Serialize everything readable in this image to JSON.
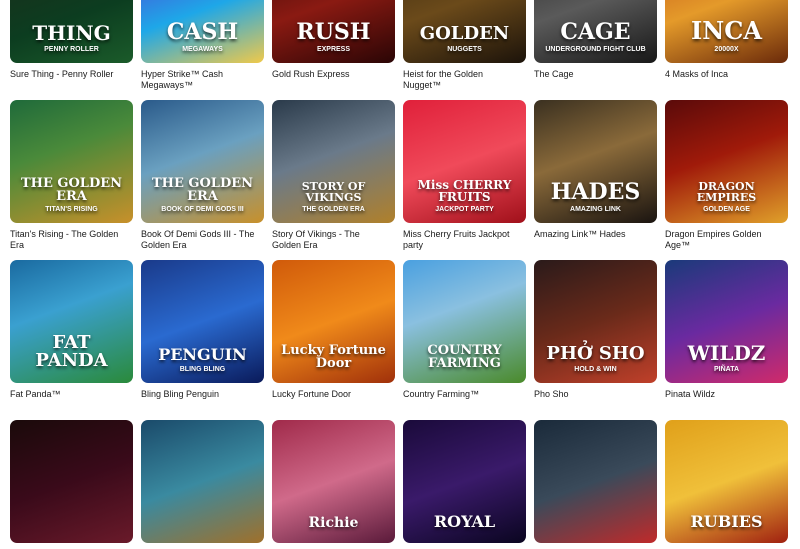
{
  "games": [
    {
      "title": "Sure Thing - Penny Roller",
      "art": "THING",
      "sub": "PENNY ROLLER",
      "bg": "linear-gradient(160deg,#1e2a1a,#0c3d20 60%,#1b5b2a)",
      "fs": 20
    },
    {
      "title": "Hyper Strike™ Cash Megaways™",
      "art": "CASH",
      "sub": "MEGAWAYS",
      "bg": "linear-gradient(160deg,#5b2fd0,#1ea7e8 55%,#f0c94a)",
      "fs": 22
    },
    {
      "title": "Gold Rush Express",
      "art": "RUSH",
      "sub": "EXPRESS",
      "bg": "linear-gradient(160deg,#3b0b0b,#8a1a12 50%,#2a0505)",
      "fs": 22
    },
    {
      "title": "Heist for the Golden Nugget™",
      "art": "GOLDEN",
      "sub": "NUGGETS",
      "bg": "linear-gradient(160deg,#3a2a12,#6b4a1a 50%,#1c130a)",
      "fs": 18
    },
    {
      "title": "The Cage",
      "art": "CAGE",
      "sub": "UNDERGROUND FIGHT CLUB",
      "bg": "linear-gradient(160deg,#2a2a2a,#5a5a5a 50%,#181818)",
      "fs": 22
    },
    {
      "title": "4 Masks of Inca",
      "art": "INCA",
      "sub": "20000X",
      "bg": "linear-gradient(160deg,#c2521a,#e49a2a 50%,#6b2a0a)",
      "fs": 24
    },
    {
      "title": "Titan's Rising - The Golden Era",
      "art": "THE GOLDEN ERA",
      "sub": "TITAN'S RISING",
      "bg": "linear-gradient(160deg,#1f6a3a,#4a8a3a 40%,#c8902a)",
      "fs": 13
    },
    {
      "title": "Book Of Demi Gods III - The Golden Era",
      "art": "THE GOLDEN ERA",
      "sub": "BOOK OF DEMI GODS III",
      "bg": "linear-gradient(160deg,#2a5a8a,#6aa0c0 45%,#c8902a)",
      "fs": 13
    },
    {
      "title": "Story Of Vikings - The Golden Era",
      "art": "STORY OF VIKINGS",
      "sub": "THE GOLDEN ERA",
      "bg": "linear-gradient(160deg,#2a3a4a,#6a7a8a 45%,#b0802a)",
      "fs": 11
    },
    {
      "title": "Miss Cherry Fruits Jackpot party",
      "art": "Miss CHERRY FRUITS",
      "sub": "JACKPOT PARTY",
      "bg": "linear-gradient(160deg,#e0203a,#f04a5a 50%,#a0101a)",
      "fs": 12
    },
    {
      "title": "Amazing Link™ Hades",
      "art": "HADES",
      "sub": "AMAZING LINK",
      "bg": "linear-gradient(160deg,#3a3020,#8a6a3a 45%,#1a1410)",
      "fs": 22
    },
    {
      "title": "Dragon Empires Golden Age™",
      "art": "DRAGON EMPIRES",
      "sub": "GOLDEN AGE",
      "bg": "linear-gradient(160deg,#5a0a0a,#a01a0a 45%,#e0a02a)",
      "fs": 11
    },
    {
      "title": "Fat Panda™",
      "art": "FAT PANDA",
      "sub": "",
      "bg": "linear-gradient(160deg,#1a6aa0,#3aa0d0 40%,#2a8a3a)",
      "fs": 18
    },
    {
      "title": "Bling Bling Penguin",
      "art": "PENGUIN",
      "sub": "BLING BLING",
      "bg": "linear-gradient(160deg,#1a3a8a,#2a6ad0 50%,#0a1a5a)",
      "fs": 16
    },
    {
      "title": "Lucky Fortune Door",
      "art": "Lucky Fortune Door",
      "sub": "",
      "bg": "linear-gradient(160deg,#d05a0a,#f08a1a 50%,#a0300a)",
      "fs": 13
    },
    {
      "title": "Country Farming™",
      "art": "COUNTRY FARMING",
      "sub": "",
      "bg": "linear-gradient(160deg,#4aa0e0,#8ac0e0 40%,#4a8a2a)",
      "fs": 13
    },
    {
      "title": "Pho Sho",
      "art": "PHỞ SHO",
      "sub": "HOLD & WIN",
      "bg": "linear-gradient(160deg,#2a1a1a,#6a2a1a 50%,#c0402a)",
      "fs": 18
    },
    {
      "title": "Pinata Wildz",
      "art": "WILDZ",
      "sub": "PIÑATA",
      "bg": "linear-gradient(160deg,#1a3a7a,#6a2aa0 50%,#d02a6a)",
      "fs": 20
    },
    {
      "title": "",
      "art": "",
      "sub": "",
      "bg": "linear-gradient(160deg,#1a0a0a,#3a0a1a 50%,#6a1a2a)",
      "fs": 14
    },
    {
      "title": "",
      "art": "",
      "sub": "",
      "bg": "linear-gradient(160deg,#1a4a6a,#3a8aa0 50%,#a0702a)",
      "fs": 14
    },
    {
      "title": "",
      "art": "Richie",
      "sub": "",
      "bg": "linear-gradient(160deg,#a02a4a,#d06a8a 50%,#5a1a3a)",
      "fs": 14
    },
    {
      "title": "",
      "art": "ROYAL",
      "sub": "",
      "bg": "linear-gradient(160deg,#1a0a3a,#3a1a6a 50%,#0a0520)",
      "fs": 16
    },
    {
      "title": "",
      "art": "",
      "sub": "",
      "bg": "linear-gradient(160deg,#1a2a3a,#3a4a5a 50%,#c02a2a)",
      "fs": 14
    },
    {
      "title": "",
      "art": "RUBIES",
      "sub": "",
      "bg": "linear-gradient(160deg,#e0a01a,#f0c03a 50%,#a02010)",
      "fs": 16
    }
  ]
}
